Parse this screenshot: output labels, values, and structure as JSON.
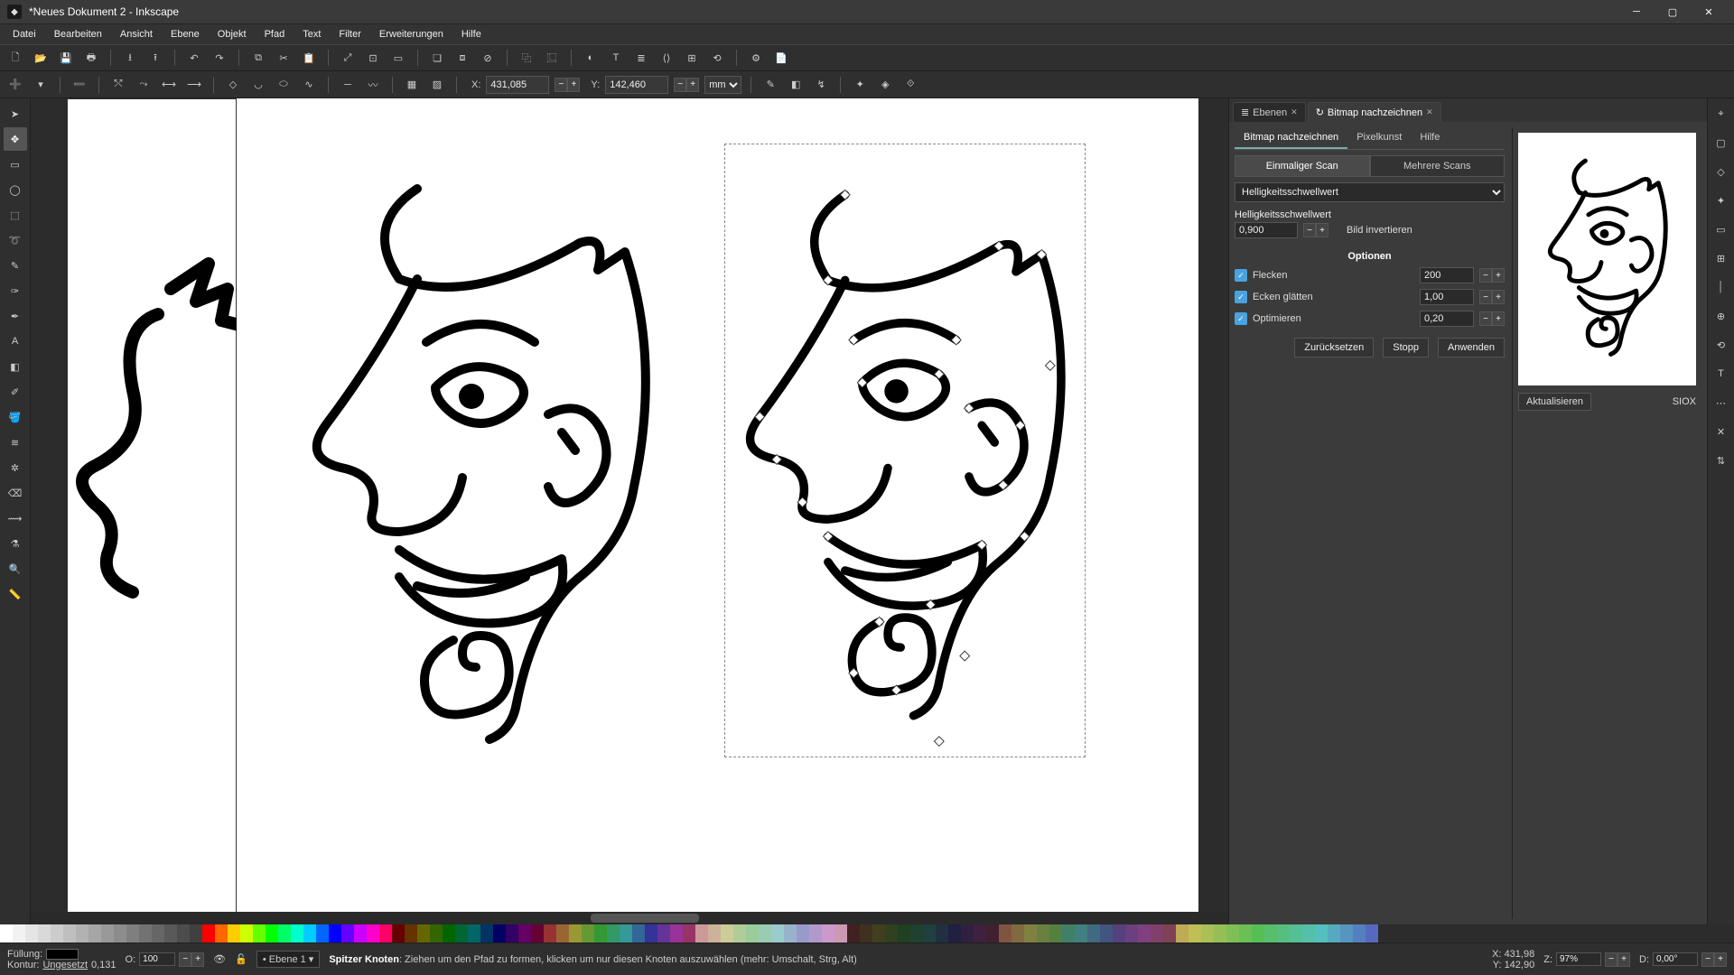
{
  "window": {
    "title": "*Neues Dokument 2 - Inkscape"
  },
  "menu": [
    "Datei",
    "Bearbeiten",
    "Ansicht",
    "Ebene",
    "Objekt",
    "Pfad",
    "Text",
    "Filter",
    "Erweiterungen",
    "Hilfe"
  ],
  "controlbar": {
    "x_label": "X:",
    "x_value": "431,085",
    "y_label": "Y:",
    "y_value": "142,460",
    "unit": "mm"
  },
  "dock": {
    "tabs": [
      {
        "label": "Ebenen",
        "active": false
      },
      {
        "label": "Bitmap nachzeichnen",
        "active": true
      }
    ],
    "subtabs": [
      "Bitmap nachzeichnen",
      "Pixelkunst",
      "Hilfe"
    ],
    "scan_tabs": [
      "Einmaliger Scan",
      "Mehrere Scans"
    ],
    "mode_select": "Helligkeitsschwellwert",
    "threshold_label": "Helligkeitsschwellwert",
    "threshold_value": "0,900",
    "invert_label": "Bild invertieren",
    "options_title": "Optionen",
    "options": [
      {
        "label": "Flecken",
        "value": "200",
        "checked": true
      },
      {
        "label": "Ecken glätten",
        "value": "1,00",
        "checked": true
      },
      {
        "label": "Optimieren",
        "value": "0,20",
        "checked": true
      }
    ],
    "update_btn": "Aktualisieren",
    "siox_label": "SIOX",
    "actions": [
      "Zurücksetzen",
      "Stopp",
      "Anwenden"
    ]
  },
  "status": {
    "fill_label": "Füllung:",
    "stroke_label": "Kontur:",
    "stroke_value": "Ungesetzt",
    "stroke_width": "0,131",
    "opacity_label": "O:",
    "opacity_value": "100",
    "layer": "Ebene 1",
    "hint_bold": "Spitzer Knoten",
    "hint_rest": ": Ziehen um den Pfad zu formen, klicken um nur diesen Knoten auszuwählen (mehr: Umschalt, Strg, Alt)",
    "coord_x_label": "X:",
    "coord_x": "431,98",
    "coord_y_label": "Y:",
    "coord_y": "142,90",
    "zoom_label": "Z:",
    "zoom": "97%",
    "rotate_label": "D:",
    "rotate": "0,00°"
  },
  "palette_colors": [
    "#ffffff",
    "#f2f2f2",
    "#e5e5e5",
    "#d9d9d9",
    "#cccccc",
    "#bfbfbf",
    "#b2b2b2",
    "#a6a6a6",
    "#999999",
    "#8c8c8c",
    "#7f7f7f",
    "#727272",
    "#666666",
    "#595959",
    "#4c4c4c",
    "#404040",
    "#ff0000",
    "#ff6600",
    "#ffcc00",
    "#ccff00",
    "#66ff00",
    "#00ff00",
    "#00ff66",
    "#00ffcc",
    "#00ccff",
    "#0066ff",
    "#0000ff",
    "#6600ff",
    "#cc00ff",
    "#ff00cc",
    "#ff0066",
    "#660000",
    "#663300",
    "#666600",
    "#336600",
    "#006600",
    "#006633",
    "#006666",
    "#003366",
    "#000066",
    "#330066",
    "#660066",
    "#660033",
    "#993333",
    "#996633",
    "#999933",
    "#669933",
    "#339933",
    "#339966",
    "#339999",
    "#336699",
    "#333399",
    "#663399",
    "#993399",
    "#993366",
    "#cc9999",
    "#ccb299",
    "#cccc99",
    "#b2cc99",
    "#99cc99",
    "#99ccb2",
    "#99cccc",
    "#99b2cc",
    "#9999cc",
    "#b299cc",
    "#cc99cc",
    "#cc99b2",
    "#402020",
    "#403020",
    "#404020",
    "#304020",
    "#204020",
    "#204030",
    "#204040",
    "#203040",
    "#202040",
    "#302040",
    "#402040",
    "#402030",
    "#805540",
    "#806a40",
    "#808040",
    "#6a8040",
    "#558040",
    "#40806a",
    "#408080",
    "#406a80",
    "#405580",
    "#554080",
    "#6a4080",
    "#804080",
    "#80406a",
    "#804055",
    "#bfaa55",
    "#bfbf55",
    "#aabf55",
    "#95bf55",
    "#80bf55",
    "#6abf55",
    "#55bf55",
    "#55bf6a",
    "#55bf80",
    "#55bf95",
    "#55bfaa",
    "#55bfbf",
    "#55aabf",
    "#5595bf",
    "#5580bf",
    "#556abf"
  ]
}
